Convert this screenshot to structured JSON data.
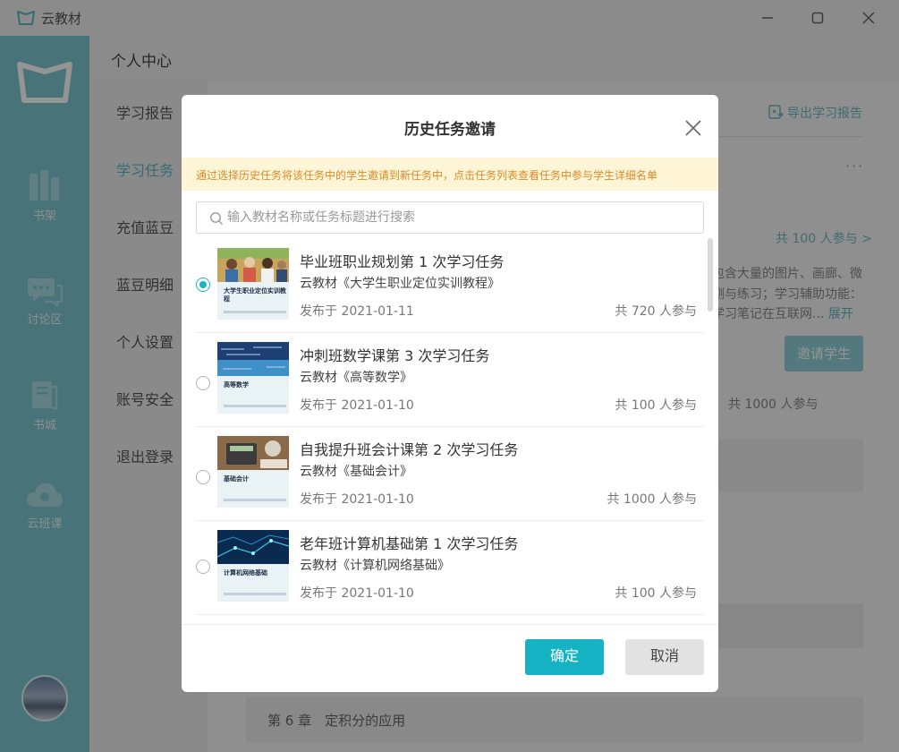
{
  "app": {
    "name": "云教材"
  },
  "rail": {
    "items": [
      {
        "label": "书架",
        "icon": "bookshelf-icon"
      },
      {
        "label": "讨论区",
        "icon": "chat-icon"
      },
      {
        "label": "书城",
        "icon": "bookstore-icon"
      },
      {
        "label": "云班课",
        "icon": "cloud-class-icon"
      }
    ]
  },
  "subnav": {
    "header": "个人中心",
    "items": [
      "学习报告",
      "学习任务",
      "充值蓝豆",
      "蓝豆明细",
      "个人设置",
      "账号安全",
      "退出登录"
    ],
    "active": "学习任务"
  },
  "main": {
    "export_label": "导出学习报告",
    "more": "···",
    "participants": "共 100 人参与 >",
    "desc_line1": "包含大量的图片、画廊、微",
    "desc_line2": "测与练习；学习辅助功能：",
    "desc_line3": "学习笔记在互联网...",
    "expand_label": "展开",
    "invite_label": "邀请学生",
    "count": "共 1000 人参与",
    "chapter": "第 6 章　定积分的应用"
  },
  "modal": {
    "title": "历史任务邀请",
    "notice": "通过选择历史任务将该任务中的学生邀请到新任务中，点击任务列表查看任务中参与学生详细名单",
    "search_placeholder": "输入教材名称或任务标题进行搜索",
    "tasks": [
      {
        "title": "毕业班职业规划第 1 次学习任务",
        "book": "云教材《大学生职业定位实训教程》",
        "date": "发布于 2021-01-11",
        "count": "共 720 人参与",
        "cover_title": "大学生职业定位实训教程",
        "selected": true
      },
      {
        "title": "冲刺班数学课第 3 次学习任务",
        "book": "云教材《高等数学》",
        "date": "发布于 2021-01-10",
        "count": "共 100 人参与",
        "cover_title": "高等数学",
        "selected": false
      },
      {
        "title": "自我提升班会计课第 2 次学习任务",
        "book": "云教材《基础会计》",
        "date": "发布于 2021-01-10",
        "count": "共 1000 人参与",
        "cover_title": "基础会计",
        "selected": false
      },
      {
        "title": "老年班计算机基础第 1 次学习任务",
        "book": "云教材《计算机网络基础》",
        "date": "发布于 2021-01-10",
        "count": "共 100 人参与",
        "cover_title": "计算机网络基础",
        "selected": false
      }
    ],
    "confirm_label": "确定",
    "cancel_label": "取消"
  },
  "colors": {
    "accent": "#15b2c3",
    "rail": "#7cc8d1",
    "notice_bg": "#fdf5d6",
    "notice_text": "#d98c2a"
  }
}
